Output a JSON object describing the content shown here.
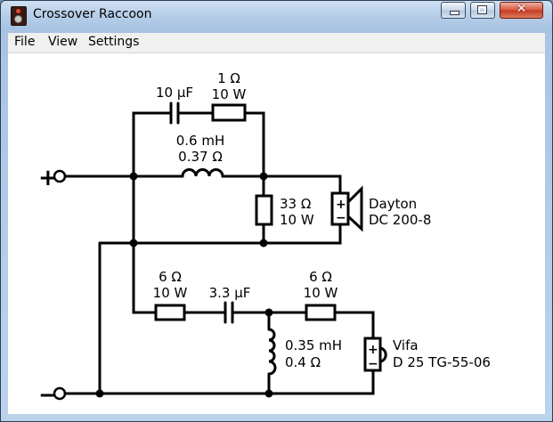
{
  "window": {
    "title": "Crossover Raccoon"
  },
  "title_buttons": {
    "close": "✕"
  },
  "menu": [
    "File",
    "View",
    "Settings"
  ],
  "terminals": {
    "plus": "+",
    "minus": "−"
  },
  "components": {
    "c1": {
      "l1": "10 µF"
    },
    "r1": {
      "l1": "1 Ω",
      "l2": "10 W"
    },
    "l1": {
      "l1": "0.6 mH",
      "l2": "0.37 Ω"
    },
    "r2": {
      "l1": "33 Ω",
      "l2": "10 W"
    },
    "woofer": {
      "l1": "Dayton",
      "l2": "DC 200-8"
    },
    "r3": {
      "l1": "6 Ω",
      "l2": "10 W"
    },
    "c2": {
      "l1": "3.3 µF"
    },
    "r4": {
      "l1": "6 Ω",
      "l2": "10 W"
    },
    "l2": {
      "l1": "0.35 mH",
      "l2": "0.4 Ω"
    },
    "tweeter": {
      "l1": "Vifa",
      "l2": "D 25 TG-55-06"
    }
  },
  "speaker_polarity": {
    "plus": "+",
    "minus": "−"
  }
}
